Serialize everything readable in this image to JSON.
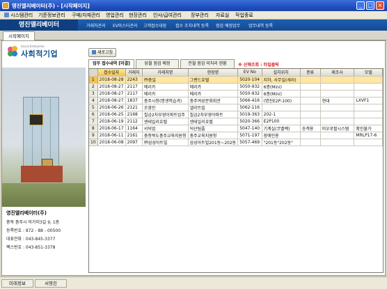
{
  "window": {
    "title": "영진엘리베이터(주) - [시작페이지]",
    "min_label": "_",
    "max_label": "□",
    "close_label": "×"
  },
  "menu": {
    "items": [
      "시스템관리",
      "기준정보관리",
      "구매/자재관리",
      "영업관리",
      "현장관리",
      "인사/급여관리",
      "장부관리",
      "자료실",
      "작업종료"
    ]
  },
  "header": {
    "brand": "영진엘리베이터",
    "nav": [
      "거래처관리",
      "EV마스터관리",
      "고객접수대장",
      "접수 조치내역 등록",
      "점검 예정업무",
      "업무내역 등록"
    ]
  },
  "main_tab": "시작페이지",
  "logo": {
    "tagline": "Social Enterprise",
    "name": "사회적기업"
  },
  "company": {
    "name": "영진엘리베이터(주)",
    "address": "충북 충주시 미가미3길 9, 1층",
    "reg_no": "등록번호 : 872 - 88 - 00500",
    "phone": "대표전화 : 043-845-3377",
    "fax": "팩스번호 : 043-851-3378"
  },
  "toolbar": {
    "refresh_label": "새로고침"
  },
  "subtabs": [
    "업무 접수내역 [미결]",
    "당월 점검 예정",
    "전월 점검 미처리 현황"
  ],
  "notice": "※ 산해조회 : 타일클릭",
  "table": {
    "columns": [
      "접수일자",
      "거래처",
      "거래처명",
      "현장명",
      "EV No",
      "설치위치",
      "종류",
      "제조사",
      "모델"
    ],
    "rows": [
      [
        "2018-08-28",
        "2243",
        "㈜충일",
        "그랜드호텔",
        "5020-104",
        "지하, 사무실(세라)",
        "",
        "",
        ""
      ],
      [
        "2018-08-27",
        "2117",
        "메리카",
        "메리카",
        "5050-932",
        "6층(Mini)",
        "",
        "",
        ""
      ],
      [
        "2018-08-27",
        "2117",
        "메리카",
        "메리카",
        "5050-932",
        "6층(Mini)",
        "",
        "",
        ""
      ],
      [
        "2018-08-27",
        "1837",
        "충주시청(명생학습과)",
        "충주여성문화회관",
        "5066-416",
        "(명진E2P-100)",
        "",
        "현대",
        "LXVF1"
      ],
      [
        "2018-06-26",
        "2121",
        "조영진",
        "엘리트빌",
        "5062-116",
        "",
        "",
        "",
        ""
      ],
      [
        "2018-06-25",
        "2168",
        "칠금2차부영아파트입주",
        "칠금2차부영아파트",
        "5019-363",
        "202-1",
        "",
        "",
        ""
      ],
      [
        "2018-06-19",
        "2112",
        "센테일리호텔",
        "센테일리호텔",
        "5020-366",
        "E2P100",
        "",
        "",
        ""
      ],
      [
        "2018-06-17",
        "1164",
        "서덕업",
        "덕산팀플",
        "5047-140",
        "기계실(코멜벡)",
        "승객용",
        "미우로팔시스템",
        "확인불가"
      ],
      [
        "2018-06-11",
        "2161",
        "충청북도충주교육지원청",
        "충주교육지원청",
        "5071-197",
        "장애인용",
        "",
        "",
        "MRLP17-6"
      ],
      [
        "2018-06-08",
        "2097",
        "㈜삼성아트빌",
        "삼성아트빌201동~202동",
        "5057-469",
        "\"201동\"202동\"",
        "",
        "",
        ""
      ]
    ]
  },
  "statusbar": {
    "left": "미래정보",
    "user": "서영진"
  }
}
